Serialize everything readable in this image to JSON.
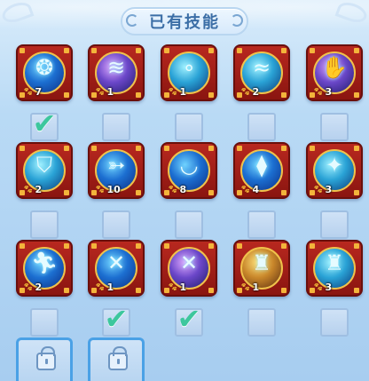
{
  "header": {
    "title": "已有技能"
  },
  "skills": [
    {
      "level": "7",
      "icon": "blue-beast-icon",
      "glyph": "❂",
      "theme": "blue",
      "selected": true
    },
    {
      "level": "1",
      "icon": "claw-swipe-icon",
      "glyph": "≋",
      "theme": "purple",
      "selected": false
    },
    {
      "level": "1",
      "icon": "bubbles-icon",
      "glyph": "∘",
      "theme": "teal",
      "selected": false
    },
    {
      "level": "2",
      "icon": "crab-claw-icon",
      "glyph": "≈",
      "theme": "teal",
      "selected": false
    },
    {
      "level": "3",
      "icon": "purple-claw-icon",
      "glyph": "✋",
      "theme": "purple",
      "selected": false
    },
    {
      "level": "2",
      "icon": "shield-icon",
      "glyph": "⛉",
      "theme": "teal",
      "selected": false
    },
    {
      "level": "10",
      "icon": "wolf-dash-icon",
      "glyph": "➳",
      "theme": "blue",
      "selected": false
    },
    {
      "level": "8",
      "icon": "helmet-icon",
      "glyph": "◡",
      "theme": "blue",
      "selected": false
    },
    {
      "level": "4",
      "icon": "armor-icon",
      "glyph": "⧫",
      "theme": "blue",
      "selected": false
    },
    {
      "level": "3",
      "icon": "crystal-icon",
      "glyph": "✦",
      "theme": "teal",
      "selected": false
    },
    {
      "level": "2",
      "icon": "runner-icon",
      "glyph": "🏃︎",
      "theme": "blue",
      "selected": false
    },
    {
      "level": "1",
      "icon": "slash-icon",
      "glyph": "✕",
      "theme": "blue",
      "selected": true
    },
    {
      "level": "1",
      "icon": "pink-slash-icon",
      "glyph": "✕",
      "theme": "purple",
      "selected": true
    },
    {
      "level": "1",
      "icon": "golden-golem-icon",
      "glyph": "♜",
      "theme": "gold",
      "selected": false
    },
    {
      "level": "3",
      "icon": "ice-golem-icon",
      "glyph": "♜",
      "theme": "teal",
      "selected": false
    }
  ],
  "locked_slots": [
    {
      "icon": "lock-icon"
    },
    {
      "icon": "lock-icon"
    }
  ],
  "colors": {
    "frame": "#b8281f",
    "check": "#3dc79d",
    "paw": "#f7b23a",
    "title": "#3b6ea6"
  }
}
